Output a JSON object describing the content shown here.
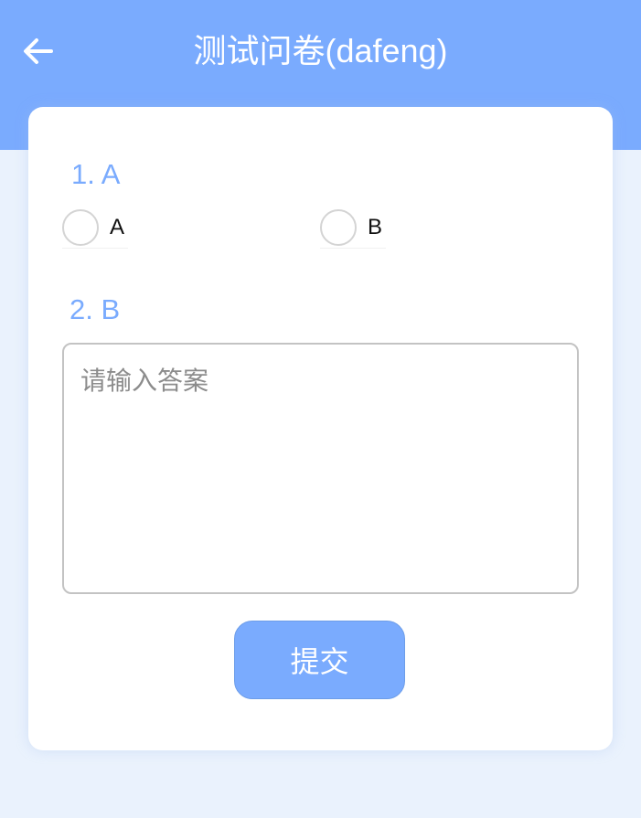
{
  "header": {
    "title": "测试问卷(dafeng)",
    "back_icon": "arrow-left-icon",
    "background_color": "#7aabfe"
  },
  "questions": [
    {
      "title": "1. A",
      "type": "radio",
      "options": [
        {
          "label": "A",
          "selected": false
        },
        {
          "label": "B",
          "selected": false
        }
      ]
    },
    {
      "title": "2. B",
      "type": "text",
      "placeholder": "请输入答案",
      "value": ""
    }
  ],
  "submit": {
    "label": "提交"
  },
  "colors": {
    "accent": "#7aabfe",
    "page_background": "#eaf2fd",
    "card_background": "#ffffff"
  }
}
